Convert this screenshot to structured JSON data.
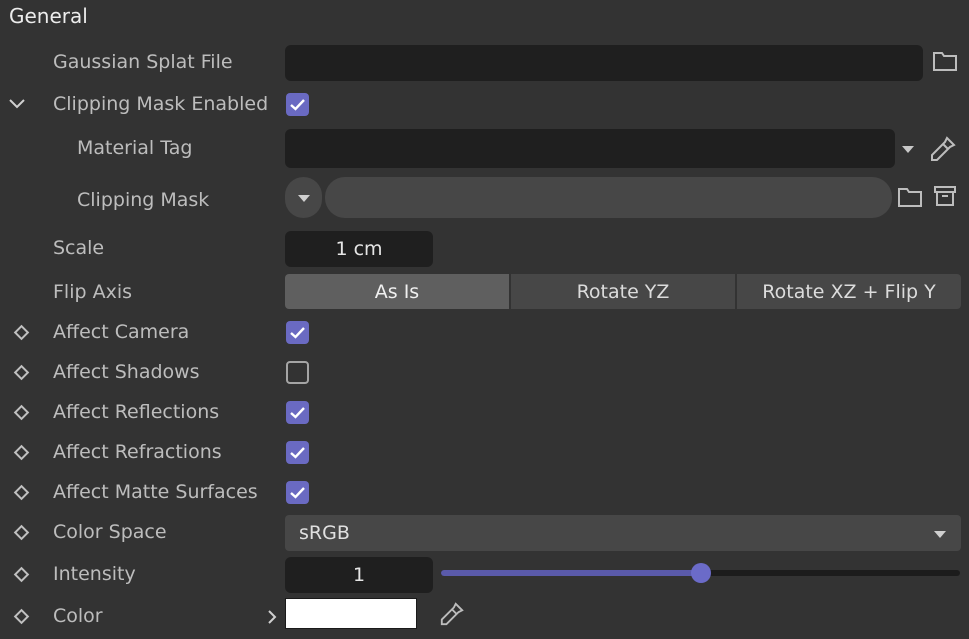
{
  "section": {
    "title": "General"
  },
  "rows": {
    "gaussian_splat_file": {
      "label": "Gaussian Splat File",
      "value": ""
    },
    "clipping_mask_enabled": {
      "label": "Clipping Mask Enabled",
      "checked": true
    },
    "material_tag": {
      "label": "Material Tag",
      "value": ""
    },
    "clipping_mask": {
      "label": "Clipping Mask",
      "value": ""
    },
    "scale": {
      "label": "Scale",
      "value": "1 cm"
    },
    "flip_axis": {
      "label": "Flip Axis",
      "options": [
        "As Is",
        "Rotate YZ",
        "Rotate XZ + Flip Y"
      ],
      "selected": "As Is"
    },
    "affect_camera": {
      "label": "Affect Camera",
      "checked": true
    },
    "affect_shadows": {
      "label": "Affect Shadows",
      "checked": false
    },
    "affect_reflections": {
      "label": "Affect Reflections",
      "checked": true
    },
    "affect_refractions": {
      "label": "Affect Refractions",
      "checked": true
    },
    "affect_matte_surfaces": {
      "label": "Affect Matte Surfaces",
      "checked": true
    },
    "color_space": {
      "label": "Color Space",
      "value": "sRGB"
    },
    "intensity": {
      "label": "Intensity",
      "value": "1",
      "slider_fraction": 0.5
    },
    "color": {
      "label": "Color",
      "swatch": "#ffffff"
    }
  },
  "colors": {
    "accent": "#6a6ac2",
    "panel_bg": "#333333",
    "field_bg": "#1f1f1f"
  }
}
